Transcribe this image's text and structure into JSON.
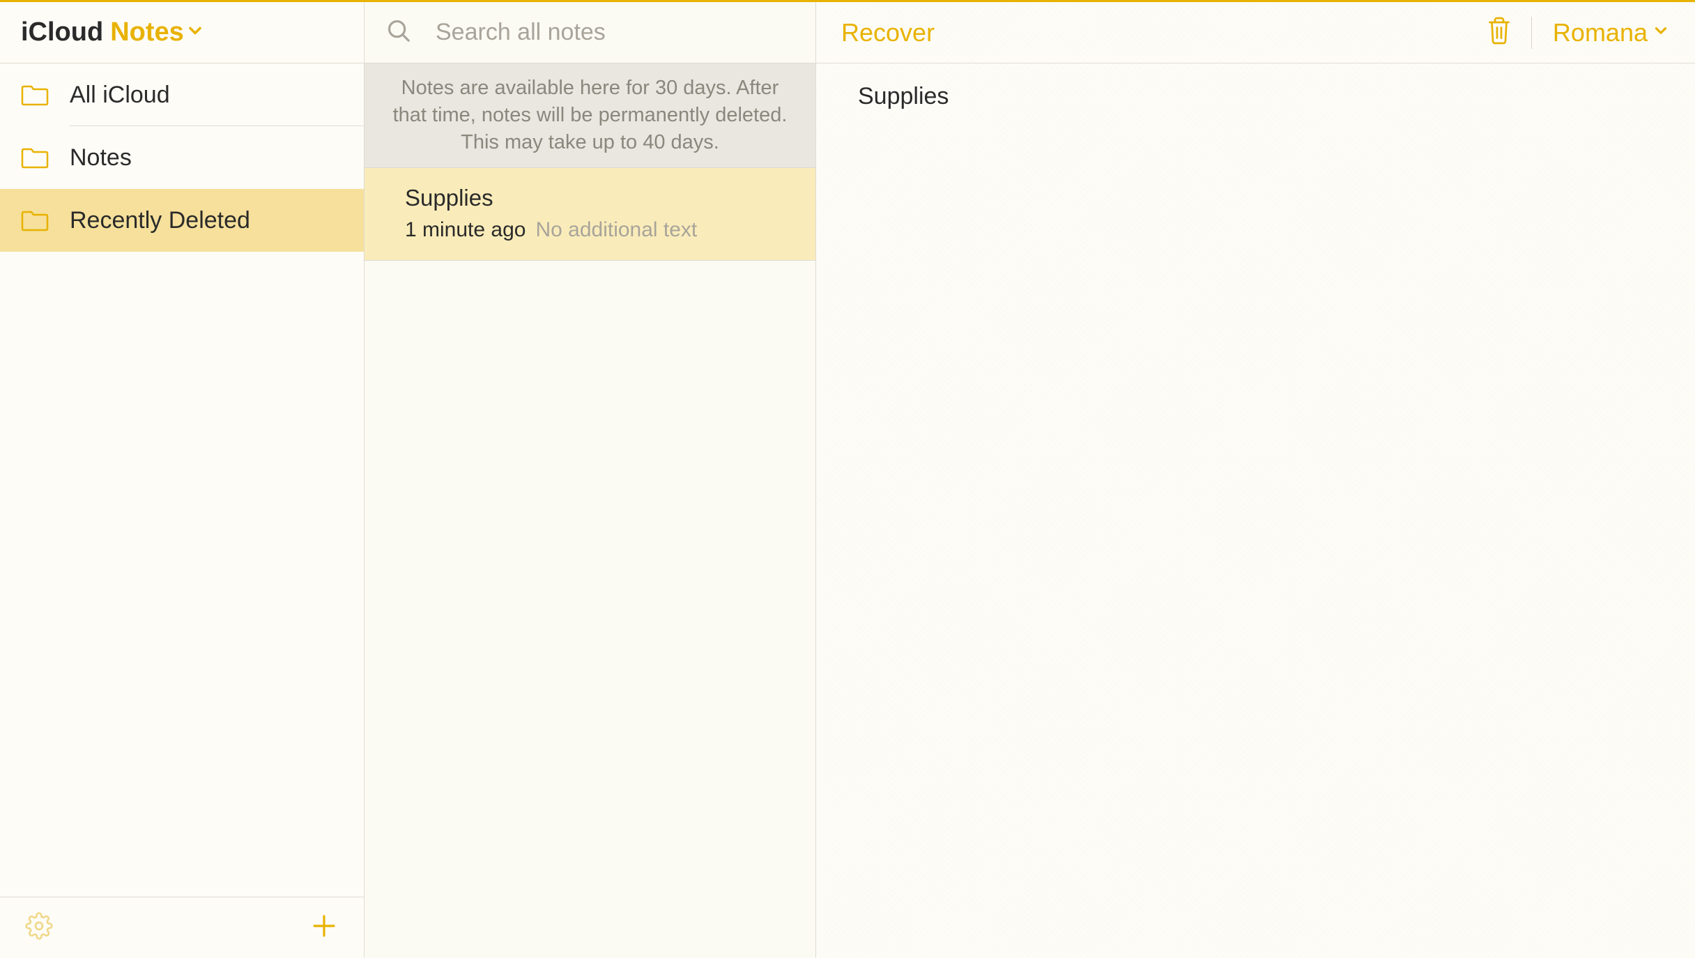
{
  "sidebar": {
    "title_icloud": "iCloud",
    "title_notes": "Notes",
    "folders": [
      {
        "label": "All iCloud",
        "selected": false
      },
      {
        "label": "Notes",
        "selected": false
      },
      {
        "label": "Recently Deleted",
        "selected": true
      }
    ]
  },
  "search": {
    "placeholder": "Search all notes"
  },
  "notes_list": {
    "deleted_notice": "Notes are available here for 30 days. After that time, notes will be permanently deleted. This may take up to 40 days.",
    "items": [
      {
        "title": "Supplies",
        "time": "1 minute ago",
        "preview": "No additional text",
        "selected": true
      }
    ]
  },
  "content": {
    "recover_label": "Recover",
    "user_name": "Romana",
    "note_title": "Supplies"
  },
  "colors": {
    "accent": "#e8b200",
    "selection": "#f6e09b"
  }
}
